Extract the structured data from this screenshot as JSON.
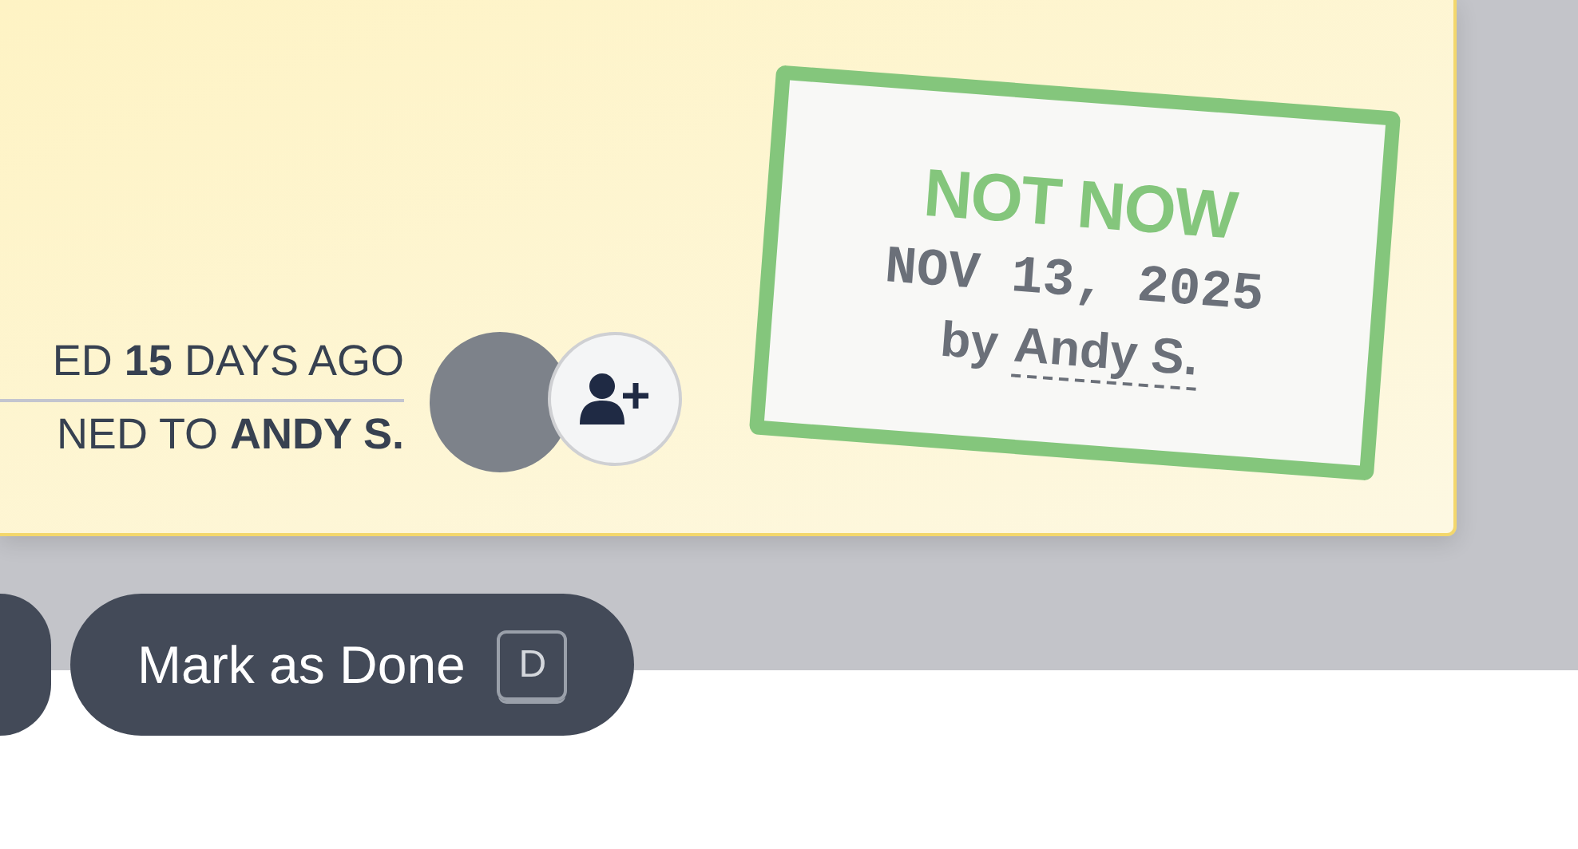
{
  "card": {
    "meta": [
      {
        "text": "ED **15** DAYS AGO"
      },
      {
        "text": "NED TO **ANDY S.**"
      }
    ],
    "stamp": {
      "kind": "not_now",
      "title": "NOT NOW",
      "date": "NOV 13, 2025",
      "by": "by",
      "author": "Andy S."
    }
  },
  "buttons": [
    {
      "label": "Mark as Done",
      "shortcut": "D"
    }
  ]
}
